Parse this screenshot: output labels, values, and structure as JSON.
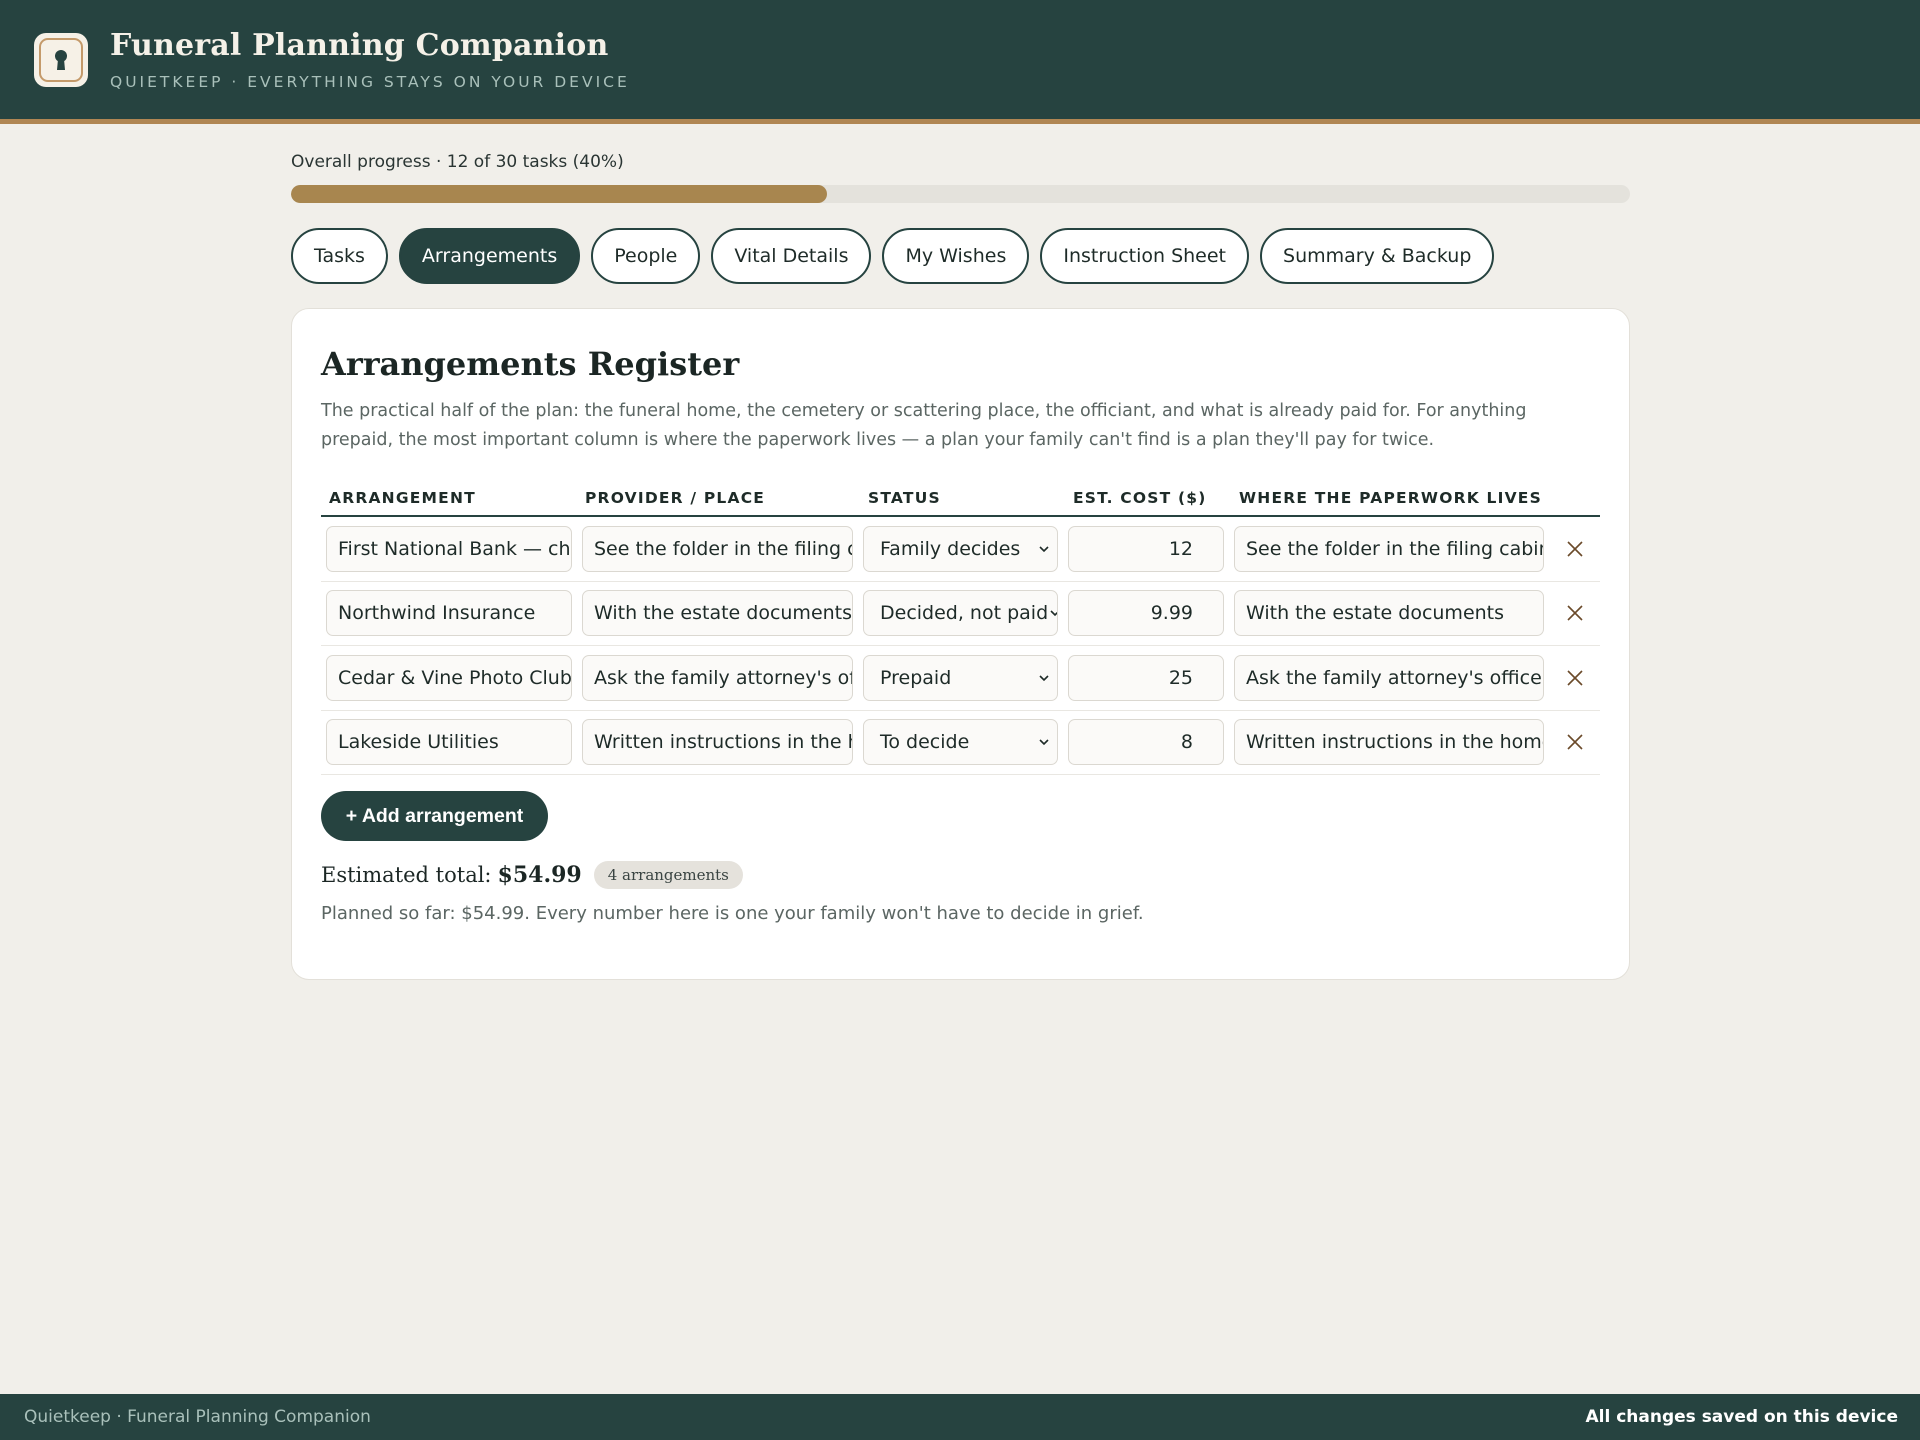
{
  "header": {
    "title": "Funeral Planning Companion",
    "subtitle": "QUIETKEEP · EVERYTHING STAYS ON YOUR DEVICE",
    "logo_icon": "keyhole-icon"
  },
  "progress": {
    "label": "Overall progress · 12 of 30 tasks (40%)",
    "completed": 12,
    "total": 30,
    "percent": 40
  },
  "tabs": [
    {
      "label": "Tasks",
      "active": false
    },
    {
      "label": "Arrangements",
      "active": true
    },
    {
      "label": "People",
      "active": false
    },
    {
      "label": "Vital Details",
      "active": false
    },
    {
      "label": "My Wishes",
      "active": false
    },
    {
      "label": "Instruction Sheet",
      "active": false
    },
    {
      "label": "Summary & Backup",
      "active": false
    }
  ],
  "register": {
    "title": "Arrangements Register",
    "description": "The practical half of the plan: the funeral home, the cemetery or scattering place, the officiant, and what is already paid for. For anything prepaid, the most important column is where the paperwork lives — a plan your family can't find is a plan they'll pay for twice.",
    "columns": [
      "ARRANGEMENT",
      "PROVIDER / PLACE",
      "STATUS",
      "EST. COST ($)",
      "WHERE THE PAPERWORK LIVES"
    ],
    "rows": [
      {
        "arrangement": "First National Bank — che",
        "provider": "See the folder in the filing ca",
        "status": "Family decides",
        "cost": "12",
        "paperwork": "See the folder in the filing cabine"
      },
      {
        "arrangement": "Northwind Insurance",
        "provider": "With the estate documents",
        "status": "Decided, not paid",
        "cost": "9.99",
        "paperwork": "With the estate documents"
      },
      {
        "arrangement": "Cedar & Vine Photo Club",
        "provider": "Ask the family attorney's offi",
        "status": "Prepaid",
        "cost": "25",
        "paperwork": "Ask the family attorney's office"
      },
      {
        "arrangement": "Lakeside Utilities",
        "provider": "Written instructions in the hc",
        "status": "To decide",
        "cost": "8",
        "paperwork": "Written instructions in the home s"
      }
    ],
    "add_button": "+ Add arrangement",
    "total_label": "Estimated total:",
    "total_value": "$54.99",
    "count_badge": "4 arrangements",
    "planned_note": "Planned so far: $54.99. Every number here is one your family won't have to decide in grief."
  },
  "footer": {
    "left": "Quietkeep · Funeral Planning Companion",
    "right": "All changes saved on this device"
  },
  "colors": {
    "primary": "#264340",
    "accent": "#b08653",
    "progress_fill": "#a8864f",
    "background": "#f1efea"
  }
}
